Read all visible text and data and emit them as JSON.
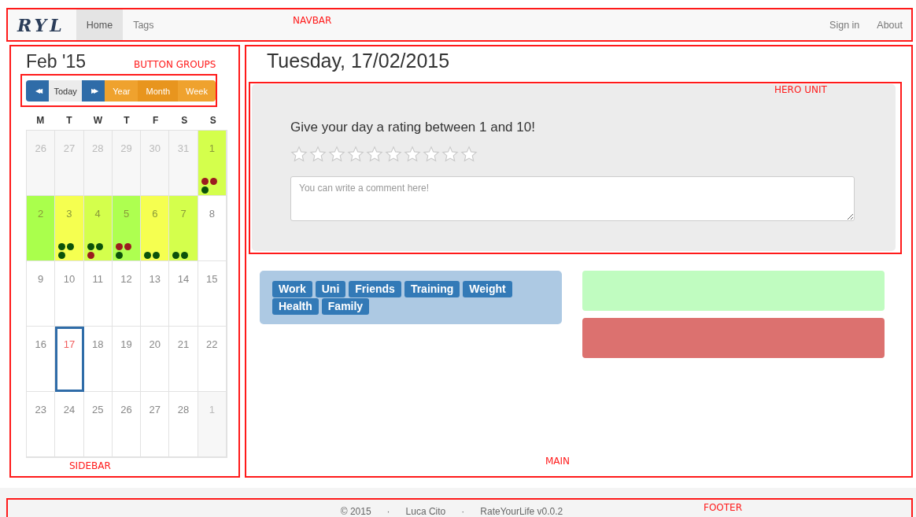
{
  "navbar": {
    "annotation": "NAVBAR",
    "logo": "RYL",
    "links": [
      {
        "label": "Home",
        "selected": true
      },
      {
        "label": "Tags",
        "selected": false
      }
    ],
    "right_links": [
      "Sign in",
      "About"
    ]
  },
  "sidebar": {
    "annotation": "SIDEBAR",
    "month": "Feb '15",
    "button_groups": {
      "annotation": "BUTTON GROUPS",
      "buttons": [
        {
          "kind": "nav",
          "label": "◀◀",
          "selected": false
        },
        {
          "kind": "plain",
          "label": "Today",
          "selected": false
        },
        {
          "kind": "nav",
          "label": "▶▶",
          "selected": false
        },
        {
          "kind": "view",
          "label": "Year",
          "selected": false
        },
        {
          "kind": "view",
          "label": "Month",
          "selected": true
        },
        {
          "kind": "view",
          "label": "Week",
          "selected": false
        }
      ]
    },
    "weekdays": [
      "M",
      "T",
      "W",
      "T",
      "F",
      "S",
      "S"
    ],
    "days": [
      {
        "label": "26",
        "other_month": true,
        "selected": false,
        "today": false
      },
      {
        "label": "27",
        "other_month": true,
        "selected": false,
        "today": false
      },
      {
        "label": "28",
        "other_month": true,
        "selected": false,
        "today": false
      },
      {
        "label": "29",
        "other_month": true,
        "selected": false,
        "today": false
      },
      {
        "label": "30",
        "other_month": true,
        "selected": false,
        "today": false
      },
      {
        "label": "31",
        "other_month": true,
        "selected": false,
        "today": false
      },
      {
        "label": "1",
        "other_month": false,
        "selected": false,
        "today": false,
        "color": "#d4ff4c",
        "dots": [
          {
            "color": "#9b1b1f"
          },
          {
            "color": "#9b1b1f"
          },
          {
            "color": "#0b520b"
          }
        ]
      },
      {
        "label": "2",
        "other_month": false,
        "selected": false,
        "today": false,
        "color": "#aaff4c"
      },
      {
        "label": "3",
        "other_month": false,
        "selected": false,
        "today": false,
        "color": "#f5ff50",
        "dots": [
          {
            "color": "#0b520b"
          },
          {
            "color": "#0b520b"
          },
          {
            "color": "#0b520b"
          }
        ]
      },
      {
        "label": "4",
        "other_month": false,
        "selected": false,
        "today": false,
        "color": "#d4ff4c",
        "dots": [
          {
            "color": "#0b520b"
          },
          {
            "color": "#0b520b"
          },
          {
            "color": "#9b1b1f"
          }
        ]
      },
      {
        "label": "5",
        "other_month": false,
        "selected": false,
        "today": false,
        "color": "#aeff50",
        "dots": [
          {
            "color": "#9b1b1f"
          },
          {
            "color": "#9b1b1f"
          },
          {
            "color": "#0b520b"
          }
        ]
      },
      {
        "label": "6",
        "other_month": false,
        "selected": false,
        "today": false,
        "color": "#f5ff50",
        "dots": [
          {
            "color": "#0b520b"
          },
          {
            "color": "#0b520b"
          }
        ]
      },
      {
        "label": "7",
        "other_month": false,
        "selected": false,
        "today": false,
        "color": "#d4ff4c",
        "dots": [
          {
            "color": "#0b520b"
          },
          {
            "color": "#0b520b"
          }
        ]
      },
      {
        "label": "8",
        "other_month": false,
        "selected": false,
        "today": false
      },
      {
        "label": "9",
        "other_month": false,
        "selected": false,
        "today": false
      },
      {
        "label": "10",
        "other_month": false,
        "selected": false,
        "today": false
      },
      {
        "label": "11",
        "other_month": false,
        "selected": false,
        "today": false
      },
      {
        "label": "12",
        "other_month": false,
        "selected": false,
        "today": false
      },
      {
        "label": "13",
        "other_month": false,
        "selected": false,
        "today": false
      },
      {
        "label": "14",
        "other_month": false,
        "selected": false,
        "today": false
      },
      {
        "label": "15",
        "other_month": false,
        "selected": false,
        "today": false
      },
      {
        "label": "16",
        "other_month": false,
        "selected": false,
        "today": false
      },
      {
        "label": "17",
        "other_month": false,
        "selected": true,
        "today": true
      },
      {
        "label": "18",
        "other_month": false,
        "selected": false,
        "today": false
      },
      {
        "label": "19",
        "other_month": false,
        "selected": false,
        "today": false
      },
      {
        "label": "20",
        "other_month": false,
        "selected": false,
        "today": false
      },
      {
        "label": "21",
        "other_month": false,
        "selected": false,
        "today": false
      },
      {
        "label": "22",
        "other_month": false,
        "selected": false,
        "today": false
      },
      {
        "label": "23",
        "other_month": false,
        "selected": false,
        "today": false
      },
      {
        "label": "24",
        "other_month": false,
        "selected": false,
        "today": false
      },
      {
        "label": "25",
        "other_month": false,
        "selected": false,
        "today": false
      },
      {
        "label": "26",
        "other_month": false,
        "selected": false,
        "today": false
      },
      {
        "label": "27",
        "other_month": false,
        "selected": false,
        "today": false
      },
      {
        "label": "28",
        "other_month": false,
        "selected": false,
        "today": false
      },
      {
        "label": "1",
        "other_month": true,
        "selected": false,
        "today": false
      }
    ]
  },
  "main": {
    "annotation": "MAIN",
    "date_title": "Tuesday, 17/02/2015",
    "hero_unit": {
      "annotation": "HERO UNIT",
      "prompt": "Give your day a rating between 1 and 10!",
      "stars": 0,
      "comment": {
        "placeholder": "You can write a comment here!"
      }
    },
    "tags": [
      "Work",
      "Uni",
      "Friends",
      "Training",
      "Weight",
      "Health",
      "Family"
    ],
    "panels": [
      {
        "color": "#c0fcc0"
      },
      {
        "color": "#dc716f"
      }
    ]
  },
  "footer": {
    "annotation": "FOOTER",
    "items": [
      "© 2015",
      "·",
      "Luca Cito",
      "·",
      "RateYourLife v0.0.2"
    ]
  }
}
